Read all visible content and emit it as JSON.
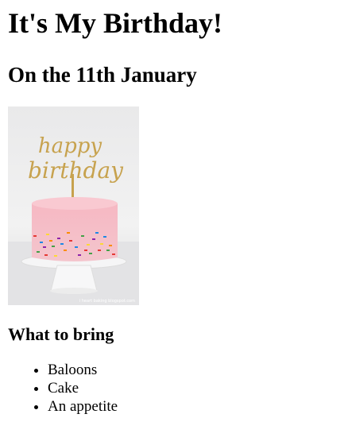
{
  "page": {
    "title": "It's My Birthday!",
    "date_heading": "On the 11th January",
    "image": {
      "watermark": "i heart baking blogspot.com",
      "topper_text_line1": "happy",
      "topper_text_line2": "birthday"
    },
    "bring_heading": "What to bring",
    "bring_items": [
      "Baloons",
      "Cake",
      "An appetite"
    ]
  },
  "colors": {
    "text": "#000000",
    "background": "#ffffff",
    "cake_frosting": "#f7bcc6",
    "topper_gold": "#c7a24e"
  }
}
